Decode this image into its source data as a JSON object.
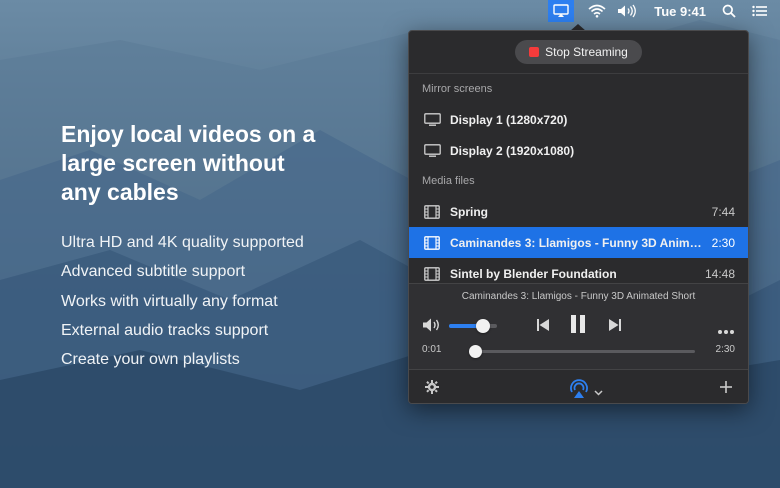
{
  "menubar": {
    "clock": "Tue 9:41",
    "icons": [
      "airplay-icon",
      "wifi-icon",
      "volume-icon",
      "search-icon",
      "list-icon"
    ],
    "accent": "#2d7ff0"
  },
  "hero": {
    "title": "Enjoy local videos on a large screen without any cables",
    "features": [
      "Ultra HD and 4K quality supported",
      "Advanced subtitle support",
      "Works with virtually any format",
      "External audio tracks support",
      "Create your own playlists"
    ]
  },
  "popover": {
    "stop_label": "Stop Streaming",
    "mirror_label": "Mirror screens",
    "displays": [
      {
        "label": "Display 1 (1280x720)"
      },
      {
        "label": "Display 2 (1920x1080)"
      }
    ],
    "media_label": "Media files",
    "media": [
      {
        "title": "Spring",
        "duration": "7:44",
        "selected": false
      },
      {
        "title": "Caminandes 3: Llamigos - Funny 3D Animated Short",
        "duration": "2:30",
        "selected": true
      },
      {
        "title": "Sintel by Blender Foundation",
        "duration": "14:48",
        "selected": false
      }
    ],
    "player": {
      "now_playing": "Caminandes 3: Llamigos - Funny 3D Animated Short",
      "volume_level": 0.7,
      "elapsed": "0:01",
      "total": "2:30",
      "progress": 0.0
    },
    "colors": {
      "selection": "#1e72e6",
      "stop": "#f43b3b"
    }
  }
}
